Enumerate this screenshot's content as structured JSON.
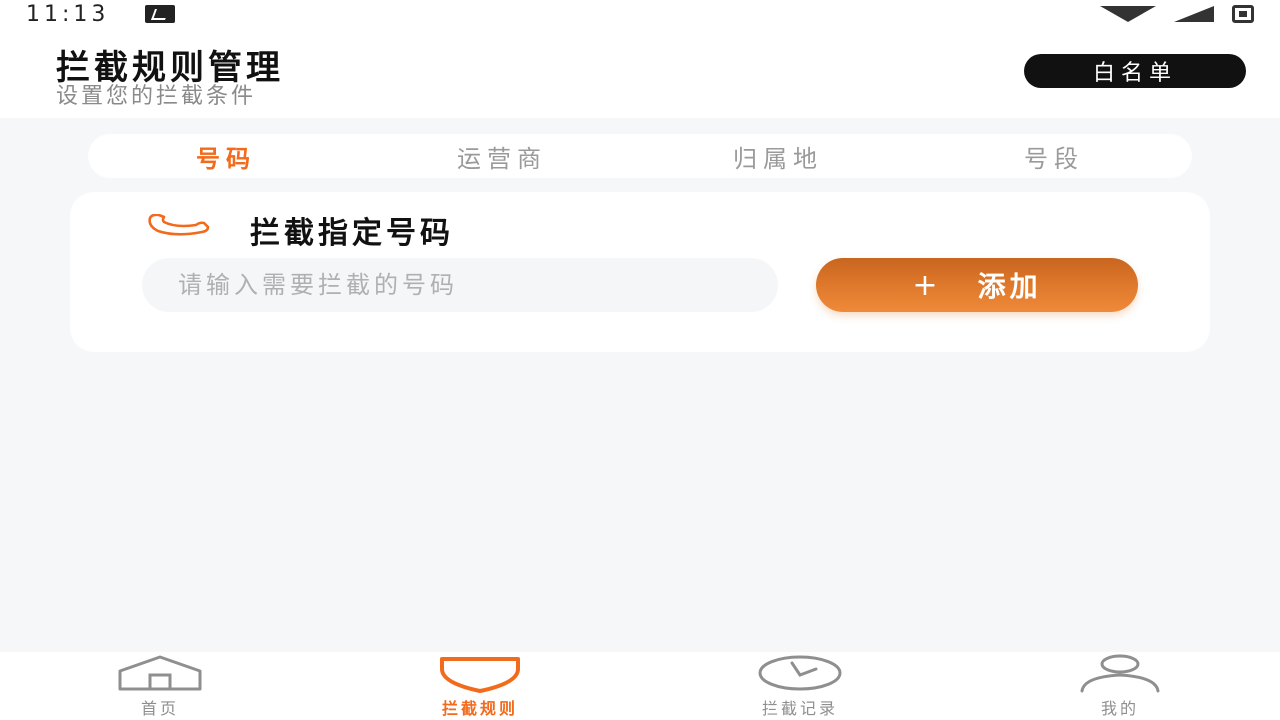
{
  "status_bar": {
    "time": "11:13"
  },
  "header": {
    "title": "拦截规则管理",
    "subtitle": "设置您的拦截条件",
    "whitelist_label": "白名单"
  },
  "tabs": [
    {
      "label": "号码",
      "active": true
    },
    {
      "label": "运营商",
      "active": false
    },
    {
      "label": "归属地",
      "active": false
    },
    {
      "label": "号段",
      "active": false
    }
  ],
  "card": {
    "title": "拦截指定号码",
    "input_placeholder": "请输入需要拦截的号码",
    "input_value": "",
    "add_plus": "+",
    "add_label": "添加"
  },
  "bottom_nav": [
    {
      "label": "首页",
      "icon": "home-icon",
      "active": false
    },
    {
      "label": "拦截规则",
      "icon": "shield-icon",
      "active": true
    },
    {
      "label": "拦截记录",
      "icon": "clock-icon",
      "active": false
    },
    {
      "label": "我的",
      "icon": "user-icon",
      "active": false
    }
  ],
  "colors": {
    "accent": "#f26a1b",
    "button_gradient_top": "#c8651f",
    "button_gradient_bottom": "#f08a3a",
    "background": "#f6f7f9"
  }
}
